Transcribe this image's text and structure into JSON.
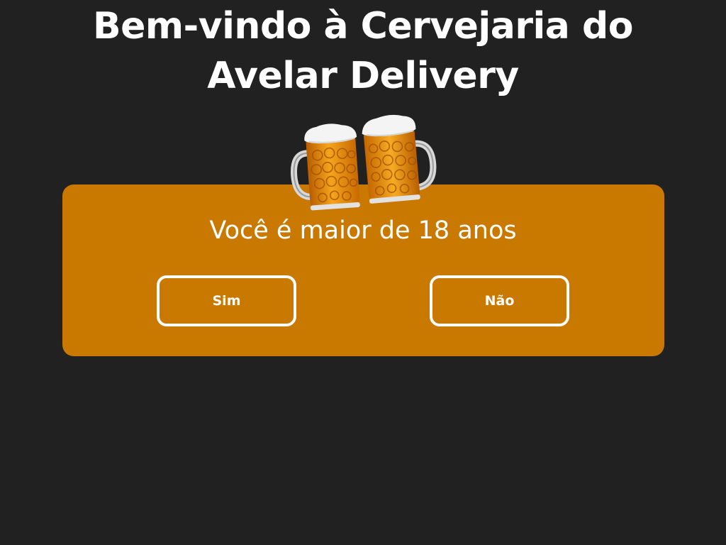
{
  "header": {
    "title_line1": "Bem-vindo à Cervejaria do",
    "title_line2": "Avelar Delivery"
  },
  "age_gate": {
    "question": "Você é maior de 18 anos",
    "yes_label": "Sim",
    "no_label": "Não"
  },
  "icons": {
    "mugs": "beer-mugs-clinking-icon"
  },
  "colors": {
    "background": "#212121",
    "card": "#c97800",
    "text": "#ffffff",
    "beer": "#e38a0a",
    "foam": "#f4f4f4"
  }
}
